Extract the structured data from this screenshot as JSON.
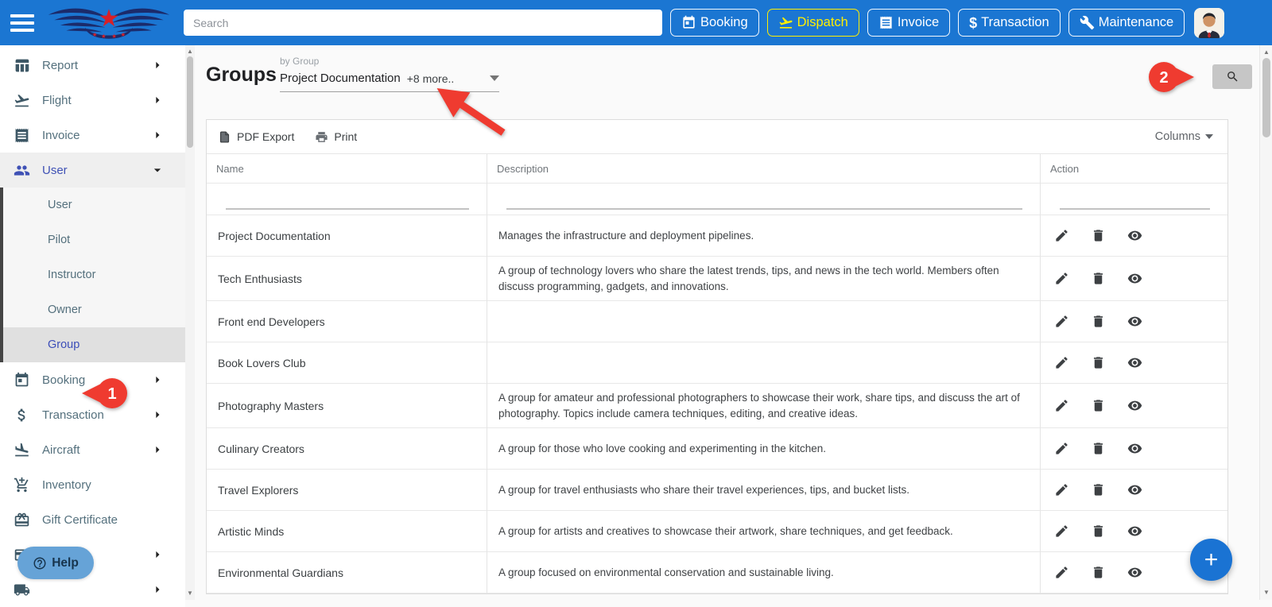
{
  "topbar": {
    "search_placeholder": "Search",
    "nav": [
      {
        "label": "Booking",
        "icon": "calendar-icon",
        "active": false
      },
      {
        "label": "Dispatch",
        "icon": "flight-takeoff-icon",
        "active": true
      },
      {
        "label": "Invoice",
        "icon": "receipt-icon",
        "active": false
      },
      {
        "label": "Transaction",
        "icon": "dollar-icon",
        "active": false
      },
      {
        "label": "Maintenance",
        "icon": "wrench-icon",
        "active": false
      }
    ],
    "colors": {
      "bar": "#1b76d2",
      "active": "#ffee00"
    }
  },
  "sidebar": {
    "items": [
      {
        "label": "Report",
        "icon": "table-chart-icon",
        "chevron": true
      },
      {
        "label": "Flight",
        "icon": "flight-takeoff-icon",
        "chevron": true
      },
      {
        "label": "Invoice",
        "icon": "receipt-icon",
        "chevron": true
      },
      {
        "label": "User",
        "icon": "people-icon",
        "chevron": "down",
        "active": true,
        "expanded": true
      },
      {
        "label": "Booking",
        "icon": "calendar-icon",
        "chevron": true
      },
      {
        "label": "Transaction",
        "icon": "dollar-icon",
        "chevron": true
      },
      {
        "label": "Aircraft",
        "icon": "flight-land-icon",
        "chevron": true
      },
      {
        "label": "Inventory",
        "icon": "add-shopping-cart-icon",
        "chevron": false
      },
      {
        "label": "Gift Certificate",
        "icon": "gift-icon",
        "chevron": false
      },
      {
        "label": "",
        "icon": "card-icon",
        "chevron": true
      },
      {
        "label": "",
        "icon": "truck-icon",
        "chevron": true
      }
    ],
    "submenu": {
      "items": [
        "User",
        "Pilot",
        "Instructor",
        "Owner",
        "Group"
      ],
      "active": "Group"
    },
    "help_label": "Help"
  },
  "main": {
    "title": "Groups",
    "filter": {
      "label": "by Group",
      "value": "Project Documentation",
      "more": "+8 more.."
    },
    "toolbar": {
      "pdf_export": "PDF Export",
      "print": "Print",
      "columns": "Columns"
    },
    "table": {
      "headers": [
        "Name",
        "Description",
        "Action"
      ],
      "actions": [
        "edit-icon",
        "delete-icon",
        "view-icon"
      ],
      "rows": [
        {
          "name": "Project Documentation",
          "description": "Manages the infrastructure and deployment pipelines."
        },
        {
          "name": "Tech Enthusiasts",
          "description": "A group of technology lovers who share the latest trends, tips, and news in the tech world. Members often discuss programming, gadgets, and innovations."
        },
        {
          "name": "Front end Developers",
          "description": ""
        },
        {
          "name": "Book Lovers Club",
          "description": ""
        },
        {
          "name": "Photography Masters",
          "description": "A group for amateur and professional photographers to showcase their work, share tips, and discuss the art of photography. Topics include camera techniques, editing, and creative ideas."
        },
        {
          "name": "Culinary Creators",
          "description": "A group for those who love cooking and experimenting in the kitchen."
        },
        {
          "name": "Travel Explorers",
          "description": "A group for travel enthusiasts who share their travel experiences, tips, and bucket lists."
        },
        {
          "name": "Artistic Minds",
          "description": "A group for artists and creatives to showcase their artwork, share techniques, and get feedback."
        },
        {
          "name": "Environmental Guardians",
          "description": "A group focused on environmental conservation and sustainable living."
        }
      ]
    }
  },
  "annotations": {
    "step1": "1",
    "step2": "2",
    "color": "#ef3b30"
  },
  "fab": {
    "label": "+"
  }
}
